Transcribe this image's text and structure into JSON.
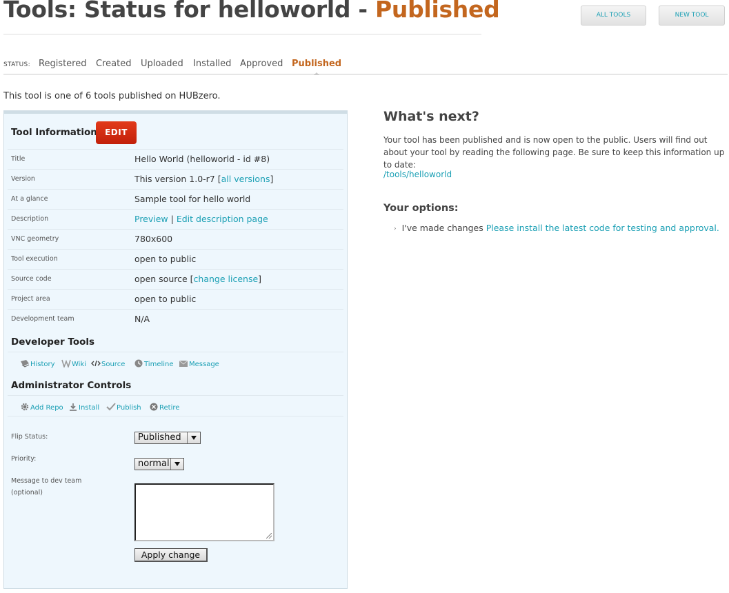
{
  "header": {
    "title_prefix": "Tools: Status for helloworld - ",
    "title_status": "Published",
    "all_tools_label": "ALL TOOLS",
    "new_tool_label": "NEW TOOL"
  },
  "status": {
    "label": "STATUS:",
    "steps": [
      "Registered",
      "Created",
      "Uploaded",
      "Installed",
      "Approved",
      "Published"
    ],
    "active": "Published"
  },
  "intro": "This tool is one of 6 tools published on HUBzero.",
  "tool_info": {
    "heading": "Tool Information",
    "edit_label": "EDIT",
    "rows": [
      {
        "label": "Title",
        "value": "Hello World (helloworld - id #8)"
      },
      {
        "label": "Version",
        "value": "This version 1.0-r7 [",
        "link": "all versions",
        "after": "]"
      },
      {
        "label": "At a glance",
        "value": "Sample tool for hello world"
      },
      {
        "label": "Description",
        "link": "Preview",
        "sep": " | ",
        "link2": "Edit description page"
      },
      {
        "label": "VNC geometry",
        "value": "780x600"
      },
      {
        "label": "Tool execution",
        "value": "open to public"
      },
      {
        "label": "Source code",
        "value": "open source [",
        "link": "change license",
        "after": "]"
      },
      {
        "label": "Project area",
        "value": "open to public"
      },
      {
        "label": "Development team",
        "value": "N/A"
      }
    ]
  },
  "developer_tools": {
    "heading": "Developer Tools",
    "links": [
      "History",
      "Wiki",
      "Source",
      "Timeline",
      "Message"
    ]
  },
  "admin_controls": {
    "heading": "Administrator Controls",
    "links": [
      "Add Repo",
      "Install",
      "Publish",
      "Retire"
    ],
    "flip_status_label": "Flip Status:",
    "flip_status_value": "Published",
    "priority_label": "Priority:",
    "priority_value": "normal",
    "message_label": "Message to dev team (optional)",
    "apply_label": "Apply change"
  },
  "next": {
    "heading": "What's next?",
    "text": "Your tool has been published and is now open to the public. Users will find out about your tool by reading the following page. Be sure to keep this information up to date:",
    "link": "/tools/helloworld",
    "options_heading": "Your options:",
    "option_text": "I've made changes ",
    "option_link": "Please install the latest code for testing and approval."
  }
}
